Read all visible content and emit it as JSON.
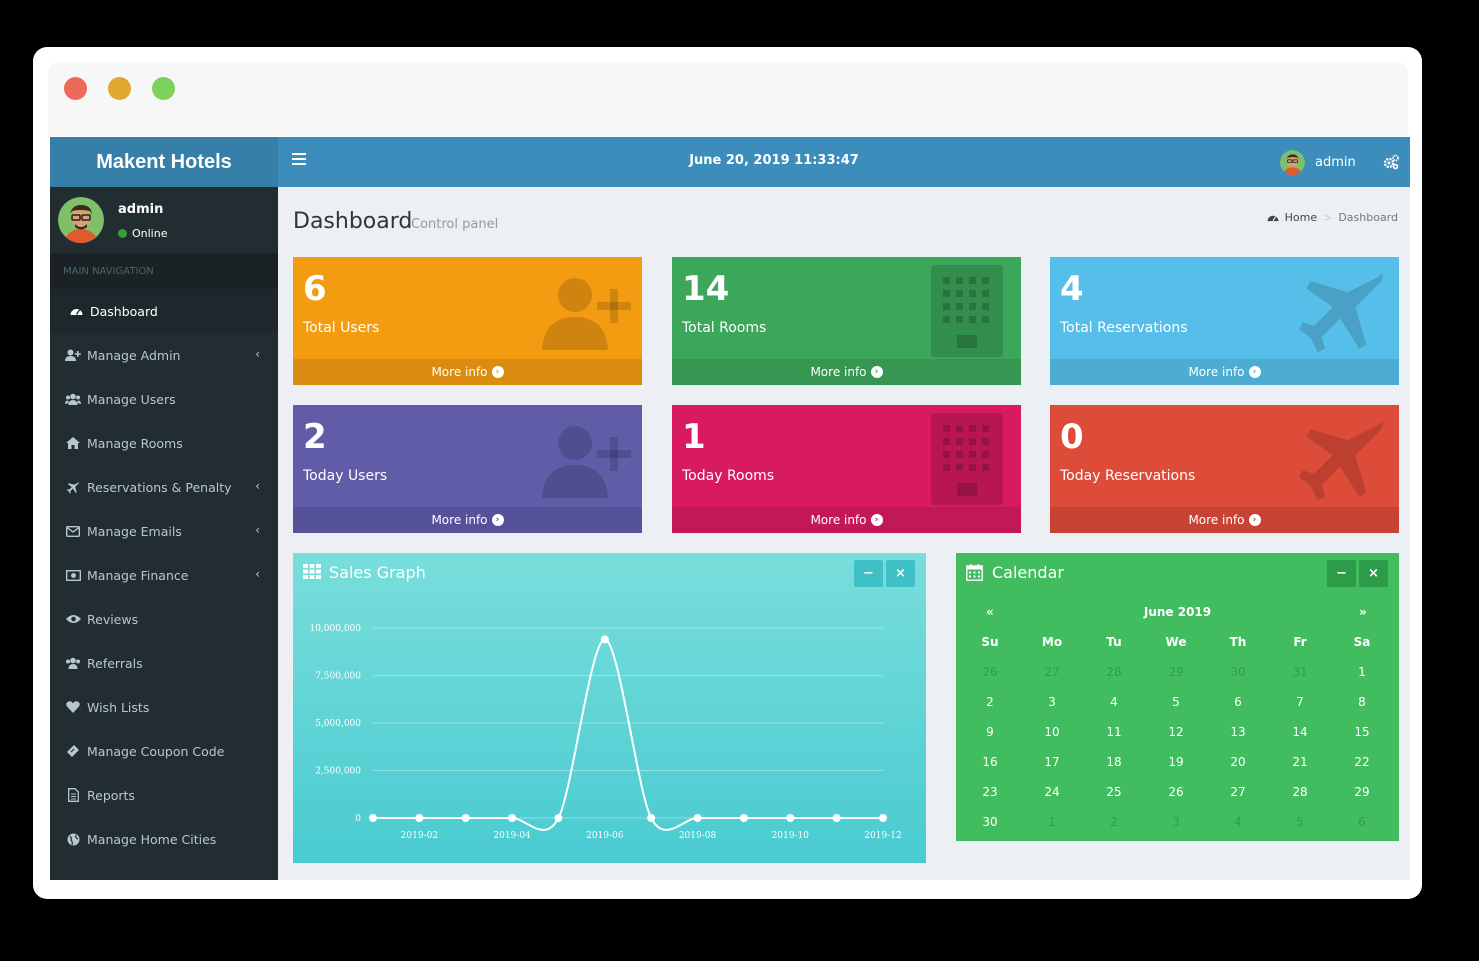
{
  "app": {
    "brand": "Makent Hotels"
  },
  "user": {
    "name": "admin",
    "status": "Online"
  },
  "sidebar": {
    "header": "MAIN NAVIGATION",
    "items": [
      {
        "label": "Dashboard",
        "icon": "dashboard-icon"
      },
      {
        "label": "Manage Admin",
        "icon": "user-plus-icon"
      },
      {
        "label": "Manage Users",
        "icon": "users-icon"
      },
      {
        "label": "Manage Rooms",
        "icon": "home-icon"
      },
      {
        "label": "Reservations & Penalty",
        "icon": "plane-icon"
      },
      {
        "label": "Manage Emails",
        "icon": "envelope-icon"
      },
      {
        "label": "Manage Finance",
        "icon": "money-icon"
      },
      {
        "label": "Reviews",
        "icon": "eye-icon"
      },
      {
        "label": "Referrals",
        "icon": "users-icon"
      },
      {
        "label": "Wish Lists",
        "icon": "heart-icon"
      },
      {
        "label": "Manage Coupon Code",
        "icon": "ticket-icon"
      },
      {
        "label": "Reports",
        "icon": "file-icon"
      },
      {
        "label": "Manage Home Cities",
        "icon": "globe-icon"
      }
    ]
  },
  "header": {
    "datetime": "June 20, 2019 11:33:47",
    "user": "admin"
  },
  "page": {
    "title": "Dashboard",
    "subtitle": "Control panel",
    "breadcrumb_home": "Home",
    "breadcrumb_current": "Dashboard"
  },
  "boxes": [
    {
      "value": "6",
      "label": "Total Users",
      "more": "More info",
      "color": "#f39c12",
      "foot": "#da8c10",
      "icon": "user-plus-icon"
    },
    {
      "value": "14",
      "label": "Total Rooms",
      "more": "More info",
      "color": "#3ca65b",
      "foot": "#369551",
      "icon": "building-icon"
    },
    {
      "value": "4",
      "label": "Total Reservations",
      "more": "More info",
      "color": "#56bfe9",
      "foot": "#4dacd2",
      "icon": "plane-icon"
    },
    {
      "value": "2",
      "label": "Today Users",
      "more": "More info",
      "color": "#605ca8",
      "foot": "#555299",
      "icon": "user-plus-icon"
    },
    {
      "value": "1",
      "label": "Today Rooms",
      "more": "More info",
      "color": "#d81b60",
      "foot": "#c21856",
      "icon": "building-icon"
    },
    {
      "value": "0",
      "label": "Today Reservations",
      "more": "More info",
      "color": "#dd4b39",
      "foot": "#c74333",
      "icon": "plane-icon"
    }
  ],
  "sales_panel": {
    "title": "Sales Graph",
    "minimize": "−",
    "close": "×"
  },
  "calendar_panel": {
    "title": "Calendar",
    "minimize": "−",
    "close": "×",
    "month": "June 2019",
    "prev": "«",
    "next": "»",
    "weekdays": [
      "Su",
      "Mo",
      "Tu",
      "We",
      "Th",
      "Fr",
      "Sa"
    ],
    "weeks": [
      [
        "26",
        "27",
        "28",
        "29",
        "30",
        "31",
        "1"
      ],
      [
        "2",
        "3",
        "4",
        "5",
        "6",
        "7",
        "8"
      ],
      [
        "9",
        "10",
        "11",
        "12",
        "13",
        "14",
        "15"
      ],
      [
        "16",
        "17",
        "18",
        "19",
        "20",
        "21",
        "22"
      ],
      [
        "23",
        "24",
        "25",
        "26",
        "27",
        "28",
        "29"
      ],
      [
        "30",
        "1",
        "2",
        "3",
        "4",
        "5",
        "6"
      ]
    ],
    "muted": [
      [
        0,
        0
      ],
      [
        0,
        1
      ],
      [
        0,
        2
      ],
      [
        0,
        3
      ],
      [
        0,
        4
      ],
      [
        0,
        5
      ],
      [
        5,
        1
      ],
      [
        5,
        2
      ],
      [
        5,
        3
      ],
      [
        5,
        4
      ],
      [
        5,
        5
      ],
      [
        5,
        6
      ]
    ]
  },
  "chart_data": {
    "type": "line",
    "x": [
      "2019-01",
      "2019-02",
      "2019-03",
      "2019-04",
      "2019-05",
      "2019-06",
      "2019-07",
      "2019-08",
      "2019-09",
      "2019-10",
      "2019-11",
      "2019-12"
    ],
    "x_tick_labels": [
      "2019-02",
      "2019-04",
      "2019-06",
      "2019-08",
      "2019-10",
      "2019-12"
    ],
    "series": [
      {
        "values": [
          0,
          0,
          0,
          0,
          0,
          9400000,
          0,
          0,
          0,
          0,
          0,
          0
        ]
      }
    ],
    "y_ticks": [
      "0",
      "2,500,000",
      "5,000,000",
      "7,500,000",
      "10,000,000"
    ],
    "ylim": [
      0,
      10000000
    ],
    "grid": true,
    "line_color": "#ffffff"
  }
}
